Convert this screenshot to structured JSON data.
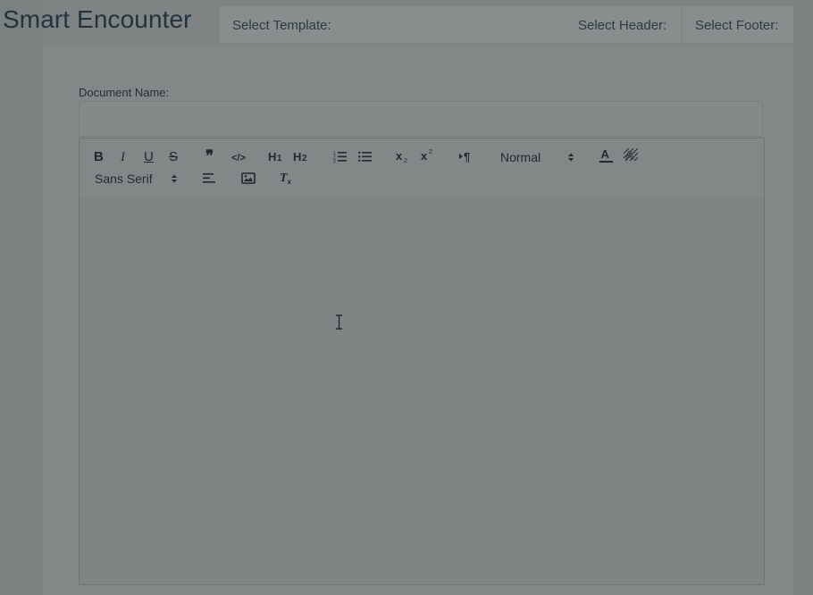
{
  "app": {
    "title": "Smart Encounter"
  },
  "topbar": {
    "select_template_label": "Select Template:",
    "select_header_label": "Select Header:",
    "select_footer_label": "Select Footer:"
  },
  "form": {
    "document_name_label": "Document Name:",
    "document_name_value": ""
  },
  "toolbar": {
    "buttons": [
      {
        "name": "bold",
        "glyph": "B"
      },
      {
        "name": "italic",
        "glyph": "I"
      },
      {
        "name": "underline",
        "glyph": "U"
      },
      {
        "name": "strike",
        "glyph": "S"
      },
      {
        "name": "blockquote",
        "glyph": "❞"
      },
      {
        "name": "code-block",
        "glyph": "</>"
      },
      {
        "name": "header-1",
        "glyph": "H1"
      },
      {
        "name": "header-2",
        "glyph": "H2"
      },
      {
        "name": "ordered-list",
        "glyph": "ol"
      },
      {
        "name": "bullet-list",
        "glyph": "ul"
      },
      {
        "name": "subscript",
        "glyph": "x2"
      },
      {
        "name": "superscript",
        "glyph": "x2"
      },
      {
        "name": "direction-rtl",
        "glyph": "¶"
      },
      {
        "name": "text-color",
        "glyph": "A"
      },
      {
        "name": "background-color",
        "glyph": "A"
      },
      {
        "name": "align",
        "glyph": "align"
      },
      {
        "name": "image",
        "glyph": "image"
      },
      {
        "name": "clean",
        "glyph": "Tx"
      }
    ],
    "size_picker_value": "Normal",
    "font_picker_value": "Sans Serif"
  },
  "editor": {
    "content": ""
  },
  "colors": {
    "overlay_background": "#7f8384",
    "title_text": "#22333e",
    "toolbar_icon": "#1e2932"
  }
}
